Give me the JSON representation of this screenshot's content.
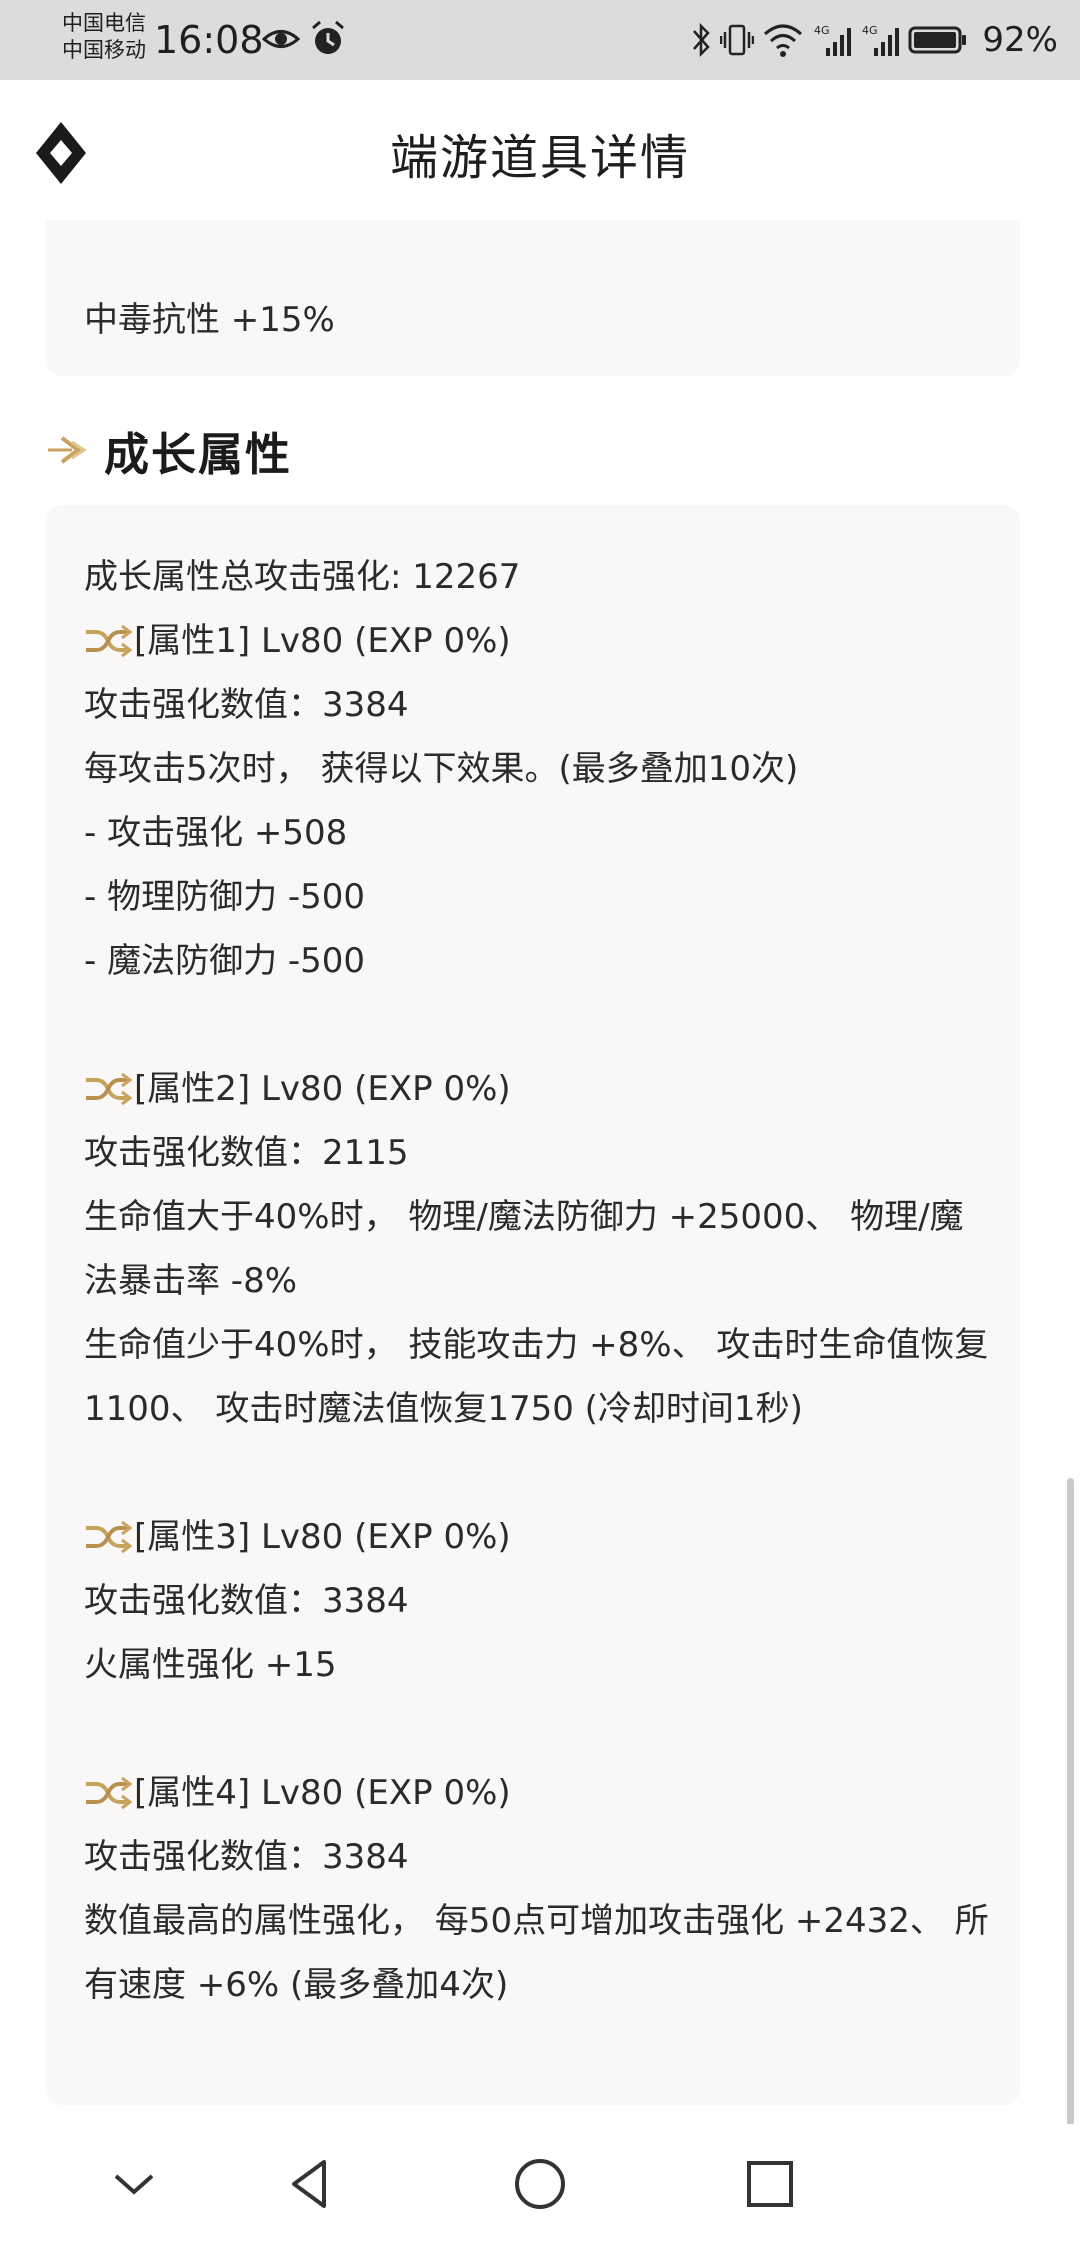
{
  "status_bar": {
    "carrier_1": "中国电信",
    "carrier_2": "中国移动",
    "time": "16:08",
    "battery": "92%",
    "signal_1": "4G",
    "signal_2": "4G"
  },
  "header": {
    "title": "端游道具详情",
    "logo_icon": "diamond-logo-icon"
  },
  "top_card": {
    "line": "中毒抗性 +15%"
  },
  "section": {
    "icon": "arrow-right-icon",
    "title": "成长属性"
  },
  "growth": {
    "total": "成长属性总攻击强化: 12267",
    "attrs": [
      {
        "head": "[属性1] Lv80 (EXP 0%)",
        "lines": [
          "攻击强化数值：3384",
          "每攻击5次时， 获得以下效果。(最多叠加10次)",
          "- 攻击强化 +508",
          "- 物理防御力 -500",
          "- 魔法防御力 -500"
        ]
      },
      {
        "head": "[属性2] Lv80 (EXP 0%)",
        "lines": [
          "攻击强化数值：2115",
          "生命值大于40%时， 物理/魔法防御力 +25000、 物理/魔法暴击率 -8%",
          "生命值少于40%时， 技能攻击力 +8%、 攻击时生命值恢复1100、 攻击时魔法值恢复1750 (冷却时间1秒)"
        ]
      },
      {
        "head": "[属性3] Lv80 (EXP 0%)",
        "lines": [
          "攻击强化数值：3384",
          "火属性强化 +15"
        ]
      },
      {
        "head": "[属性4] Lv80 (EXP 0%)",
        "lines": [
          "攻击强化数值：3384",
          "数值最高的属性强化， 每50点可增加攻击强化 +2432、 所有速度 +6% (最多叠加4次)"
        ]
      }
    ]
  },
  "colors": {
    "accent_gold": "#c9a25e",
    "card_bg": "#faf8f6",
    "status_bg": "#dcdcdc"
  },
  "navbar": {
    "icons": [
      "chevron-down-icon",
      "back-triangle-icon",
      "home-circle-icon",
      "recents-square-icon"
    ]
  }
}
